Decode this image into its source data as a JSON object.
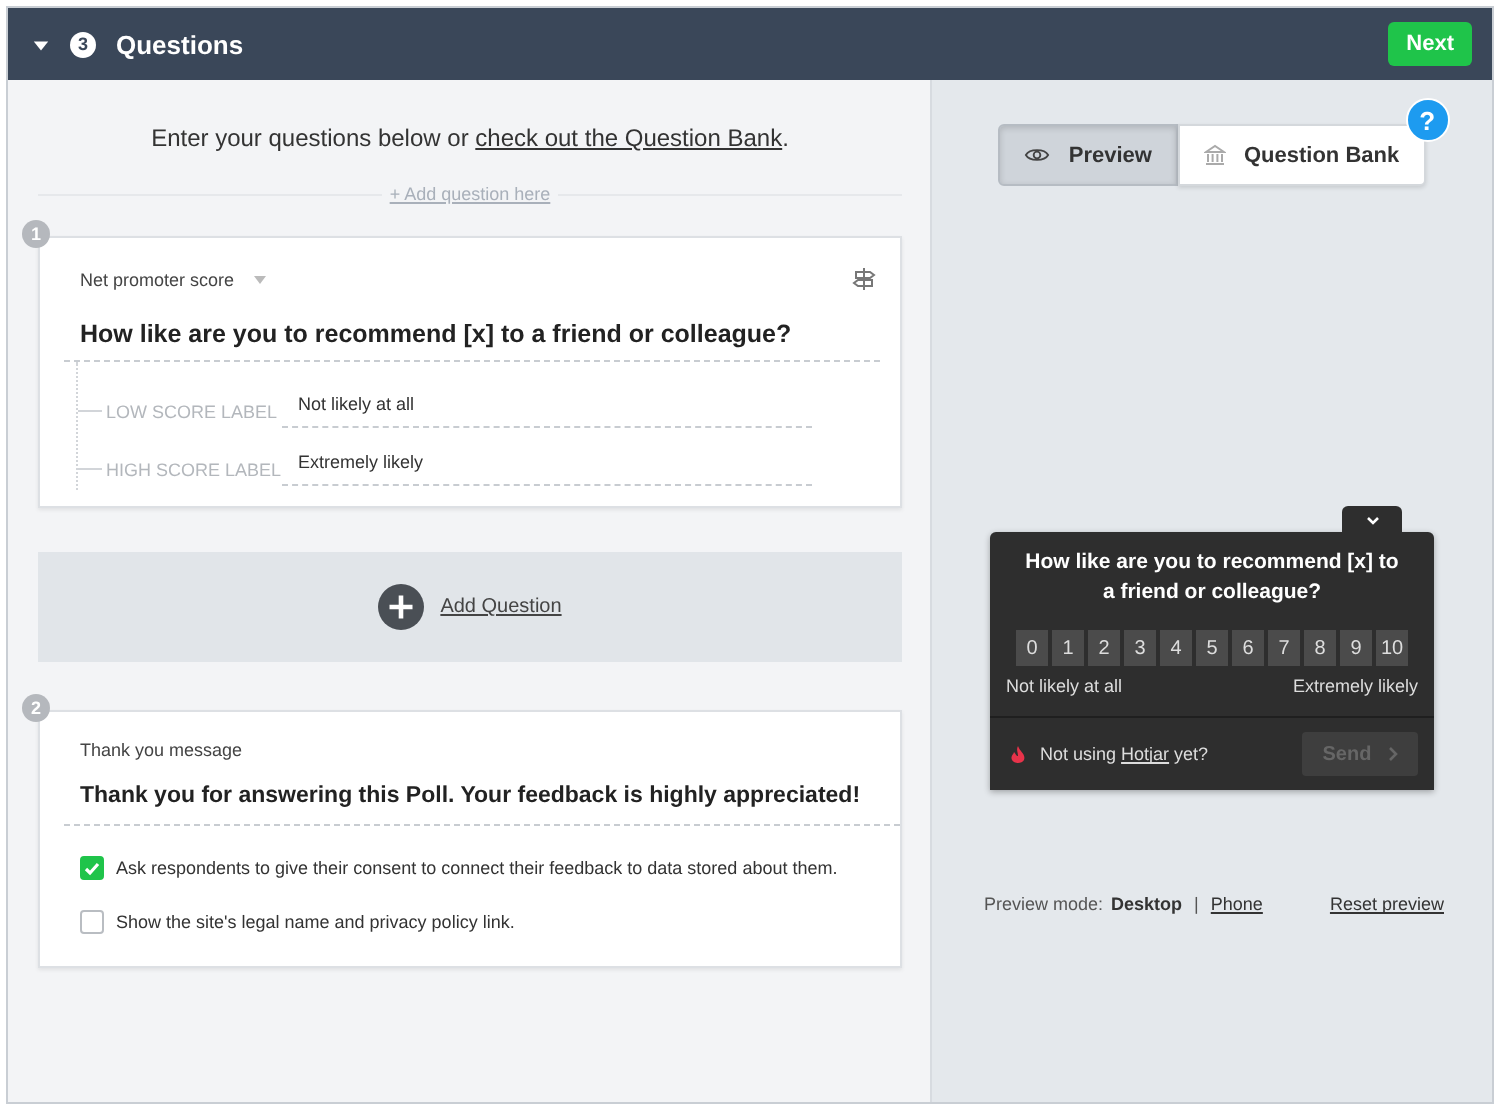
{
  "header": {
    "expanded": true,
    "step": "3",
    "title": "Questions",
    "next": "Next"
  },
  "intro": {
    "before": "Enter your questions below or ",
    "link": "check out the Question Bank",
    "after": "."
  },
  "add_here": "+ Add question here",
  "questions": [
    {
      "kind": "nps",
      "number": "1",
      "type": "Net promoter score",
      "text": "How like are you to recommend [x] to a friend or colleague?",
      "labels": [
        {
          "label": "LOW SCORE LABEL",
          "value": "Not likely at all"
        },
        {
          "label": "HIGH SCORE LABEL",
          "value": "Extremely likely"
        }
      ]
    }
  ],
  "add_question": "Add Question",
  "thank_you": {
    "number": "2",
    "heading": "Thank you message",
    "text": "Thank you for answering this Poll. Your feedback is highly appreciated!",
    "options": [
      {
        "label": "Ask respondents to give their consent to connect their feedback to data stored about them.",
        "checked": true
      },
      {
        "label": "Show the site's legal name and privacy policy link.",
        "checked": false
      }
    ]
  },
  "preview_tabs": [
    {
      "kind": "eye",
      "label": "Preview",
      "selected": true
    },
    {
      "kind": "bank",
      "label": "Question Bank",
      "selected": false
    }
  ],
  "help": "?",
  "widget": {
    "question": "How like are you to recommend [x] to a friend or colleague?",
    "scale": [
      "0",
      "1",
      "2",
      "3",
      "4",
      "5",
      "6",
      "7",
      "8",
      "9",
      "10"
    ],
    "low": "Not likely at all",
    "high": "Extremely likely",
    "promo_before": "Not using ",
    "promo_link": "Hotjar",
    "promo_after": " yet?",
    "send": "Send",
    "send_disabled": true
  },
  "preview_mode": {
    "label": "Preview mode:",
    "separator": "|",
    "options": [
      {
        "label": "Desktop",
        "selected": true
      },
      {
        "label": "Phone",
        "selected": false
      }
    ]
  },
  "reset": "Reset preview"
}
